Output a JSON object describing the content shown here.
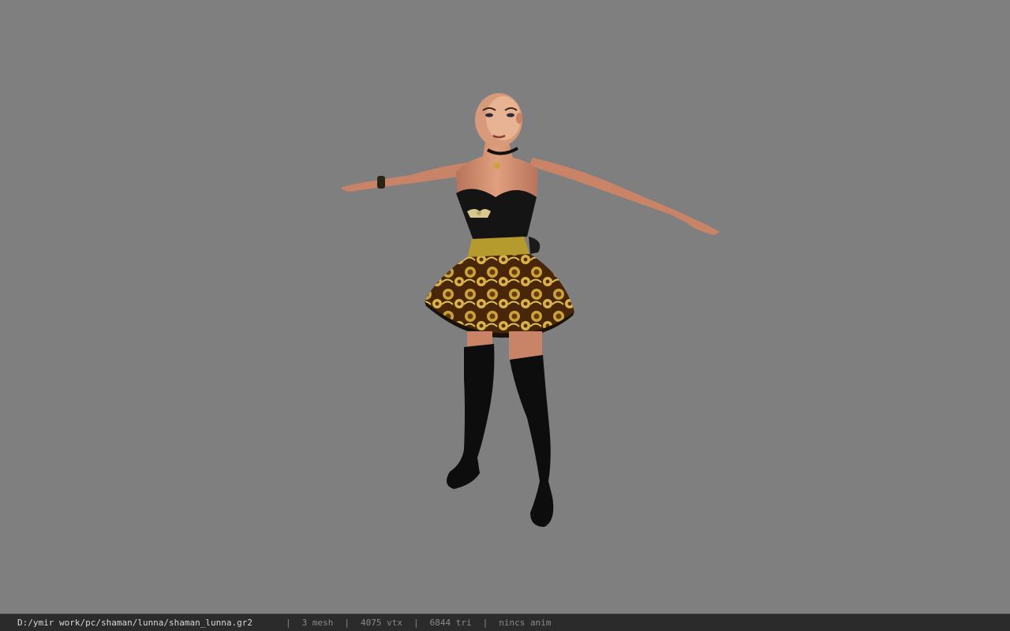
{
  "window": {
    "background_color": "#7f7f7f"
  },
  "model": {
    "description_icon": "character-model"
  },
  "statusbar": {
    "file_path": "D:/ymir work/pc/shaman/lunna/shaman_lunna.gr2",
    "separator": "|",
    "mesh_count": "3 mesh",
    "vertex_count": "4075 vtx",
    "triangle_count": "6844 tri",
    "anim_status": "nincs anim"
  }
}
